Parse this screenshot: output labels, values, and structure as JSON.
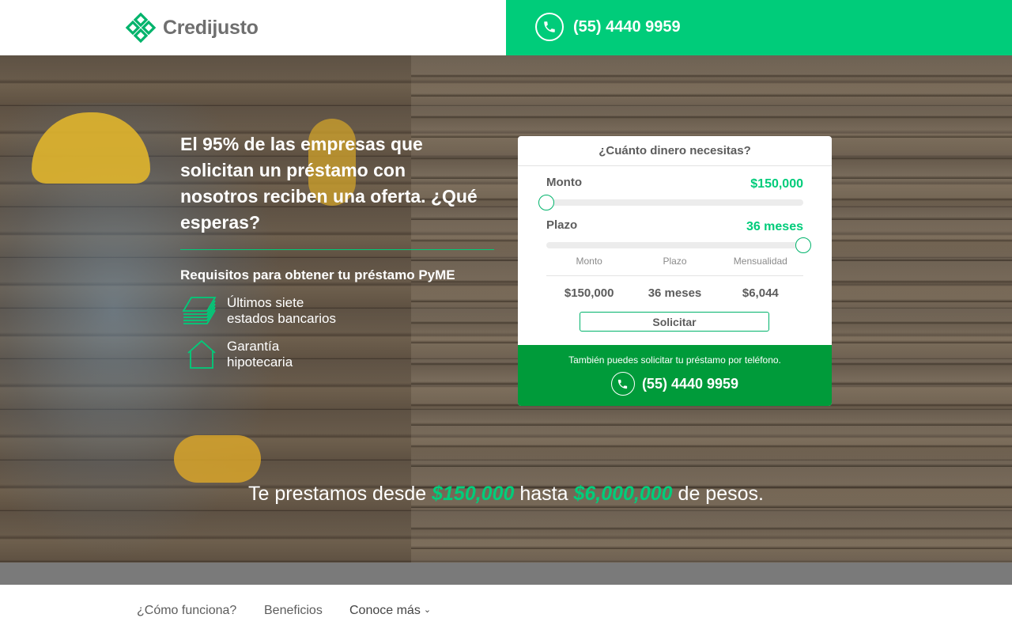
{
  "header": {
    "brand": "Credijusto",
    "phone": "(55) 4440 9959"
  },
  "hero": {
    "headline": "El 95% de las empresas que solicitan un préstamo con nosotros reciben una oferta. ¿Qué esperas?",
    "requirements_title": "Requisitos para obtener tu préstamo PyME",
    "requirements": [
      {
        "icon": "bank-statements-icon",
        "line1": "Últimos siete",
        "line2": "estados bancarios"
      },
      {
        "icon": "house-icon",
        "line1": "Garantía",
        "line2": "hipotecaria"
      }
    ],
    "tagline": {
      "prefix": "Te prestamos desde ",
      "min": "$150,000",
      "middle": " hasta ",
      "max": "$6,000,000",
      "suffix": " de pesos."
    }
  },
  "calculator": {
    "title": "¿Cuánto dinero necesitas?",
    "amount": {
      "label": "Monto",
      "value": "$150,000",
      "level": 0.0
    },
    "term": {
      "label": "Plazo",
      "value": "36 meses",
      "level": 1.0
    },
    "summary_headers": [
      "Monto",
      "Plazo",
      "Mensualidad"
    ],
    "summary_values": [
      "$150,000",
      "36 meses",
      "$6,044"
    ],
    "submit_label": "Solicitar",
    "footer_note": "También puedes solicitar tu préstamo por teléfono.",
    "footer_phone": "(55) 4440 9959"
  },
  "nav": {
    "items": [
      "¿Cómo funciona?",
      "Beneficios",
      "Conoce más"
    ]
  },
  "colors": {
    "accent": "#00cc7a",
    "footer_green": "#009b3a",
    "text_gray": "#5c5c5c"
  }
}
